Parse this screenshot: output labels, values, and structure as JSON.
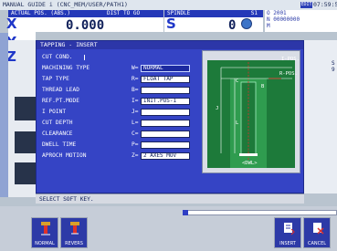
{
  "topbar": {
    "title": "MANUAL GUIDE i (CNC_MEM/USER/PATH1)",
    "badge": "EDIT",
    "clock": "07:59:5"
  },
  "status": {
    "actual_pos_label": "ACTUAL POS. (ABS.)",
    "dist_label": "DIST TO GO",
    "spindle_label": "SPINDLE",
    "spindle_no": "S1",
    "axis_x": "X",
    "axis_y": "Y",
    "axis_z": "Z",
    "x_value": "0.000",
    "s_label": "S",
    "s_value": "0",
    "o_line": "O 2001",
    "n_line": "N 00000000",
    "m_line": "M"
  },
  "dialog": {
    "title": "TAPPING - INSERT",
    "fields": [
      {
        "label": "CUT COND.",
        "code": "",
        "value": ""
      },
      {
        "label": "MACHINING TYPE",
        "code": "W=",
        "value": "NORMAL"
      },
      {
        "label": "TAP TYPE",
        "code": "R=",
        "value": "FLOAT TAP"
      },
      {
        "label": "THREAD LEAD",
        "code": "B=",
        "value": ""
      },
      {
        "label": "REF.PT.MODE",
        "code": "I=",
        "value": "INIT.POS-1"
      },
      {
        "label": "I POINT",
        "code": "J=",
        "value": ""
      },
      {
        "label": "CUT DEPTH",
        "code": "L=",
        "value": ""
      },
      {
        "label": "CLEARANCE",
        "code": "C=",
        "value": ""
      },
      {
        "label": "DWELL TIME",
        "code": "P=",
        "value": ""
      },
      {
        "label": "APROCH MOTION",
        "code": "Z=",
        "value": "2 AXES MOV"
      }
    ],
    "diagram": {
      "i_pos": "I-POS.",
      "r_pos": "R-POS.",
      "j": "J",
      "c": "C",
      "l": "L",
      "b": "B",
      "dwl": "<DWL>"
    }
  },
  "message": "SELECT SOFT KEY.",
  "softkeys": [
    {
      "label": "NORMAL",
      "icon": "tap-normal-icon"
    },
    {
      "label": "REVERS",
      "icon": "tap-reverse-icon"
    },
    {
      "label": "INSERT",
      "icon": "insert-icon"
    },
    {
      "label": "CANCEL",
      "icon": "cancel-icon"
    }
  ],
  "colors": {
    "dialog_bg": "#3544c5",
    "title_bg": "#2c36a8",
    "diagram_green": "#1d7a3a",
    "accent_red": "#e0302a"
  }
}
